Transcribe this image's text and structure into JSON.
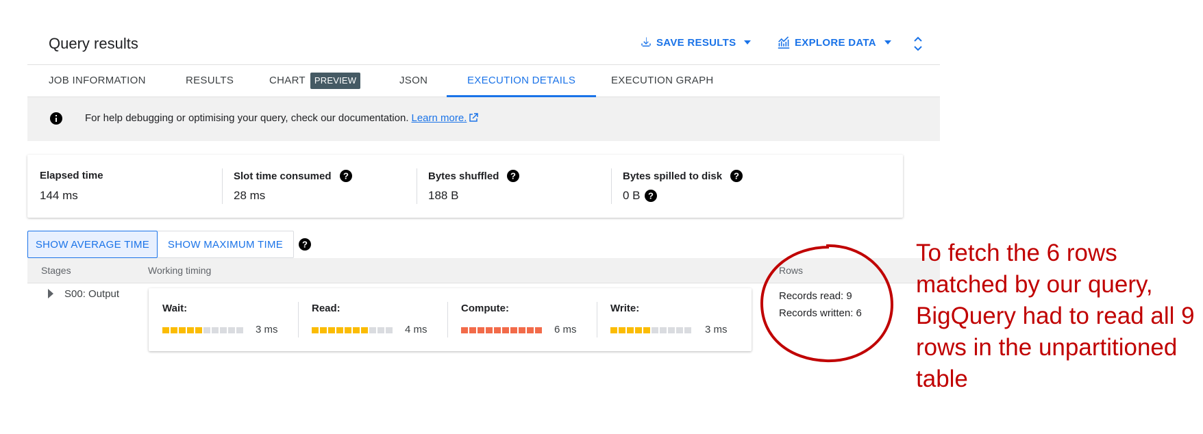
{
  "header": {
    "title": "Query results",
    "save_label": "SAVE RESULTS",
    "explore_label": "EXPLORE DATA"
  },
  "tabs": [
    {
      "label": "JOB INFORMATION"
    },
    {
      "label": "RESULTS"
    },
    {
      "label": "CHART",
      "badge": "PREVIEW"
    },
    {
      "label": "JSON"
    },
    {
      "label": "EXECUTION DETAILS",
      "active": true
    },
    {
      "label": "EXECUTION GRAPH"
    }
  ],
  "banner": {
    "text": "For help debugging or optimising your query, check our documentation.",
    "link": "Learn more."
  },
  "stats": [
    {
      "label": "Elapsed time",
      "value": "144 ms"
    },
    {
      "label": "Slot time consumed",
      "value": "28 ms"
    },
    {
      "label": "Bytes shuffled",
      "value": "188 B"
    },
    {
      "label": "Bytes spilled to disk",
      "value": "0 B"
    }
  ],
  "toggle": {
    "average": "SHOW AVERAGE TIME",
    "maximum": "SHOW MAXIMUM TIME"
  },
  "table": {
    "col_stages": "Stages",
    "col_timing": "Working timing",
    "col_rows": "Rows"
  },
  "stage": {
    "name": "S00: Output",
    "timing": [
      {
        "label": "Wait:",
        "value": "3 ms",
        "fraction": 0.5,
        "color": "#fbbc04"
      },
      {
        "label": "Read:",
        "value": "4 ms",
        "fraction": 0.7,
        "color": "#fbbc04"
      },
      {
        "label": "Compute:",
        "value": "6 ms",
        "fraction": 1.0,
        "color": "#f26b4a"
      },
      {
        "label": "Write:",
        "value": "3 ms",
        "fraction": 0.5,
        "color": "#fbbc04"
      }
    ],
    "records_read": "Records read: 9",
    "records_written": "Records written: 6"
  },
  "annotation": {
    "text": "To fetch the 6 rows matched by our query, BigQuery had to read all 9 rows in the unpartitioned table",
    "color": "#c00000"
  },
  "colors": {
    "accent": "#1a73e8",
    "badge": "#455a64"
  }
}
